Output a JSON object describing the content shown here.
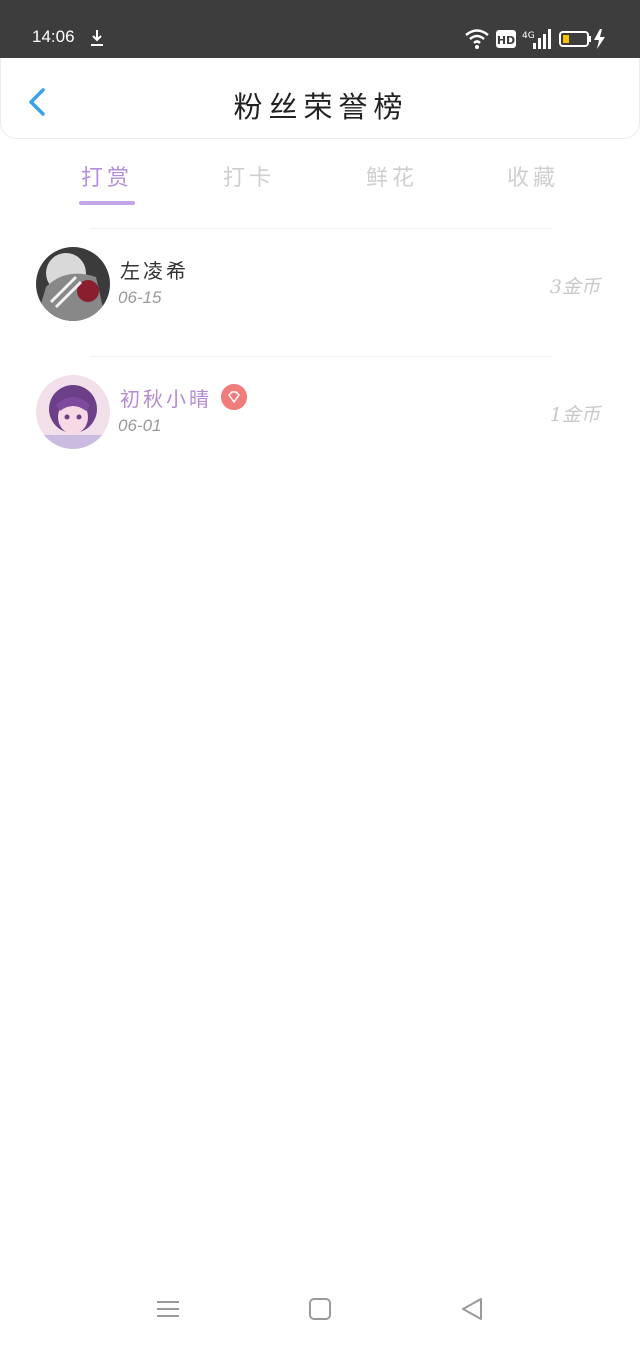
{
  "status_bar": {
    "time": "14:06",
    "icons": [
      "download-icon",
      "wifi-icon",
      "hd-icon",
      "4g-signal-icon",
      "battery-icon",
      "charging-icon"
    ],
    "hd_label": "HD",
    "network_label": "4G"
  },
  "header": {
    "title": "粉丝荣誉榜",
    "back_icon": "chevron-left-icon",
    "accent_color": "#3aa0ea"
  },
  "tabs": [
    {
      "label": "打赏",
      "active": true
    },
    {
      "label": "打卡",
      "active": false
    },
    {
      "label": "鲜花",
      "active": false
    },
    {
      "label": "收藏",
      "active": false
    }
  ],
  "tab_accent_color": "#c4a6e8",
  "rows": [
    {
      "name": "左凌希",
      "date": "06-15",
      "amount": "3金币",
      "vip": false
    },
    {
      "name": "初秋小晴",
      "date": "06-01",
      "amount": "1金币",
      "vip": true,
      "badge_icon": "diamond-icon"
    }
  ],
  "nav_bar": {
    "icons": [
      "menu-icon",
      "home-icon",
      "back-triangle-icon"
    ]
  }
}
